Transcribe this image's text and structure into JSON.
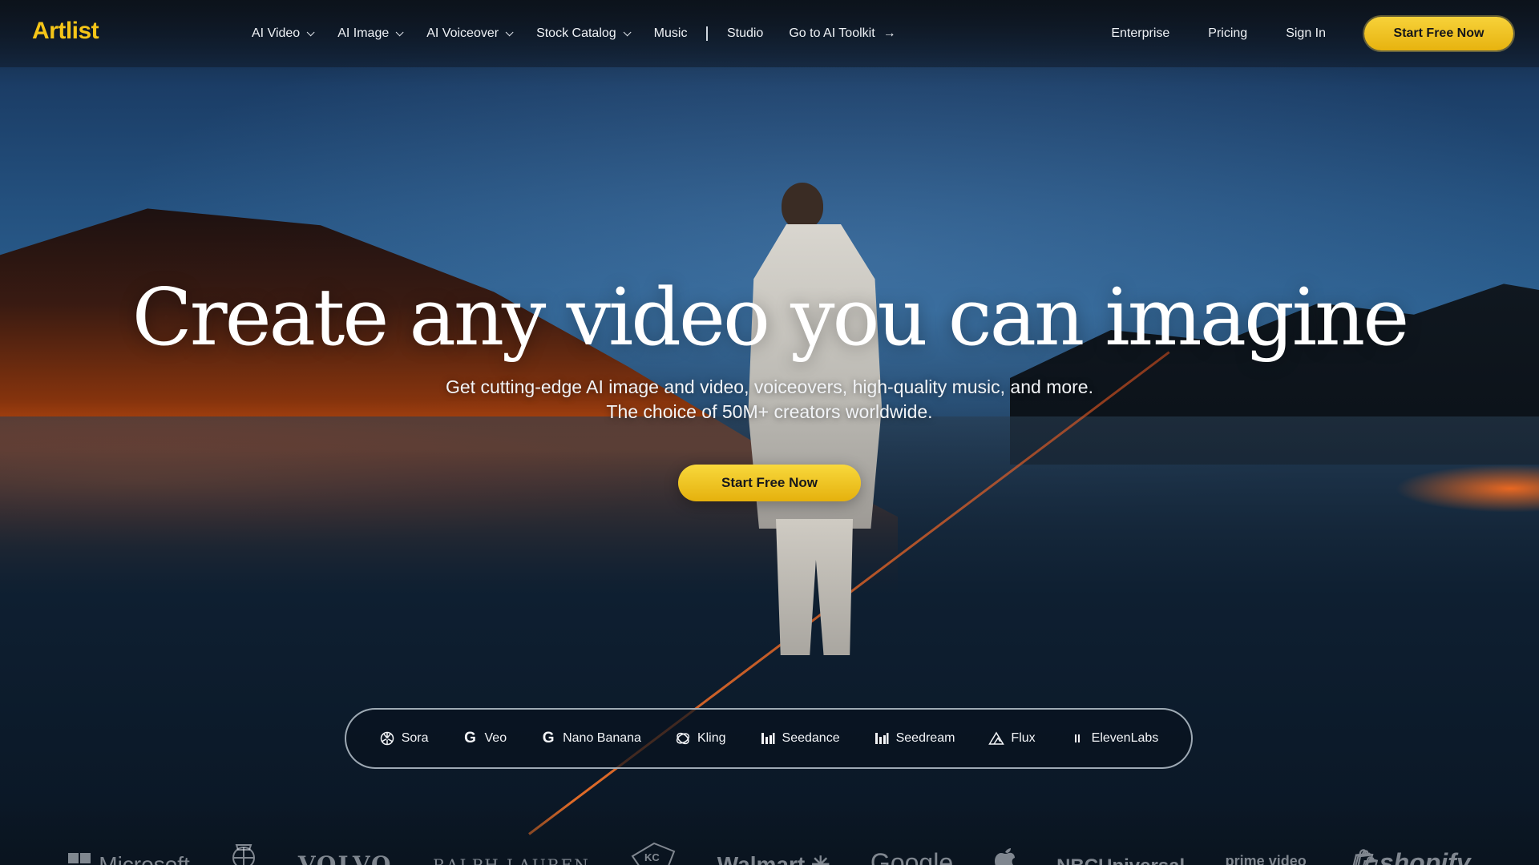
{
  "brand": {
    "logo": "Artlist",
    "accent": "#f5c518"
  },
  "nav": {
    "items": [
      {
        "label": "AI Video",
        "dropdown": true
      },
      {
        "label": "AI Image",
        "dropdown": true
      },
      {
        "label": "AI Voiceover",
        "dropdown": true
      },
      {
        "label": "Stock Catalog",
        "dropdown": true
      },
      {
        "label": "Music",
        "dropdown": false
      },
      {
        "label": "Studio",
        "dropdown": false
      },
      {
        "label": "Go to AI Toolkit",
        "dropdown": false,
        "icon": "arrow-right-icon"
      }
    ],
    "right": {
      "enterprise": "Enterprise",
      "pricing": "Pricing",
      "sign_in": "Sign In",
      "cta": "Start Free Now"
    }
  },
  "hero": {
    "headline": "Create any video you can imagine",
    "subline_1": "Get cutting-edge AI image and video, voiceovers, high-quality music, and more.",
    "subline_2": "The choice of 50M+ creators worldwide.",
    "cta": "Start Free Now"
  },
  "models": [
    {
      "label": "Sora",
      "icon": "openai-icon"
    },
    {
      "label": "Veo",
      "icon": "google-icon"
    },
    {
      "label": "Nano Banana",
      "icon": "google-icon"
    },
    {
      "label": "Kling",
      "icon": "kling-icon"
    },
    {
      "label": "Seedance",
      "icon": "bars-icon"
    },
    {
      "label": "Seedream",
      "icon": "bars-icon"
    },
    {
      "label": "Flux",
      "icon": "triangle-icon"
    },
    {
      "label": "ElevenLabs",
      "icon": "pause-bars-icon"
    }
  ],
  "logos": [
    {
      "label": "Microsoft",
      "icon": "microsoft-icon"
    },
    {
      "label": "",
      "icon": "real-madrid-crest-icon"
    },
    {
      "label": "VOLVO"
    },
    {
      "label": "RALPH LAUREN"
    },
    {
      "label": "",
      "icon": "kc-chiefs-icon"
    },
    {
      "label": "Walmart",
      "icon": "walmart-spark-icon"
    },
    {
      "label": "Google"
    },
    {
      "label": "",
      "icon": "apple-icon"
    },
    {
      "label": "NBCUniversal"
    },
    {
      "label": "prime video"
    },
    {
      "label": "shopify",
      "icon": "shopify-bag-icon"
    }
  ],
  "colors": {
    "cta_yellow": "#f3c925",
    "nav_text": "#eef1f5"
  }
}
